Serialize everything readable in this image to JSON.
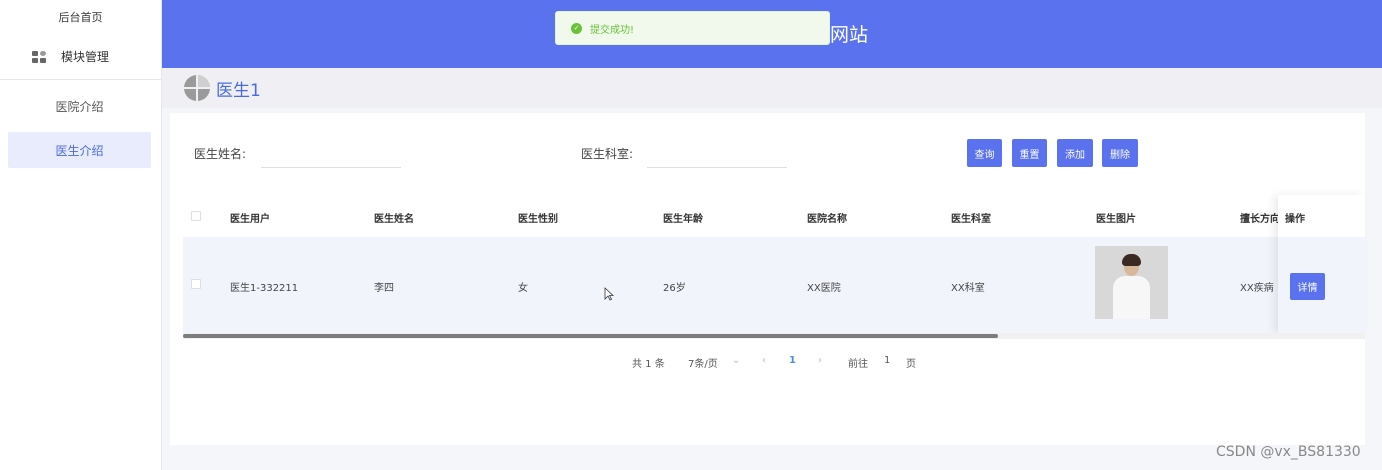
{
  "sidebar": {
    "home": "后台首页",
    "module": "模块管理",
    "items": [
      {
        "label": "医院介绍",
        "active": false
      },
      {
        "label": "医生介绍",
        "active": true
      }
    ]
  },
  "header": {
    "title": "网站"
  },
  "toast": {
    "message": "提交成功!",
    "icon": "check-circle-icon",
    "color": "#67c23a"
  },
  "page": {
    "title": "医生1"
  },
  "search": {
    "name_label": "医生姓名:",
    "name_value": "",
    "dept_label": "医生科室:",
    "dept_value": "",
    "buttons": {
      "query": "查询",
      "reset": "重置",
      "add": "添加",
      "delete": "删除"
    }
  },
  "table": {
    "columns": [
      "医生用户",
      "医生姓名",
      "医生性别",
      "医生年龄",
      "医院名称",
      "医生科室",
      "医生图片",
      "擅长方向",
      "操作"
    ],
    "rows": [
      {
        "user": "医生1-332211",
        "name": "李四",
        "gender": "女",
        "age": "26岁",
        "hospital": "XX医院",
        "dept": "XX科室",
        "photo": "doctor-photo",
        "specialty": "XX疾病",
        "action": "详情"
      }
    ]
  },
  "pagination": {
    "total": "共 1 条",
    "page_size": "7条/页",
    "current": "1",
    "goto_prefix": "前往",
    "goto_value": "1",
    "goto_suffix": "页"
  },
  "watermark": "CSDN @vx_BS81330",
  "colors": {
    "primary": "#5b72ee",
    "active_bg": "#e8ecfd",
    "success": "#67c23a"
  }
}
